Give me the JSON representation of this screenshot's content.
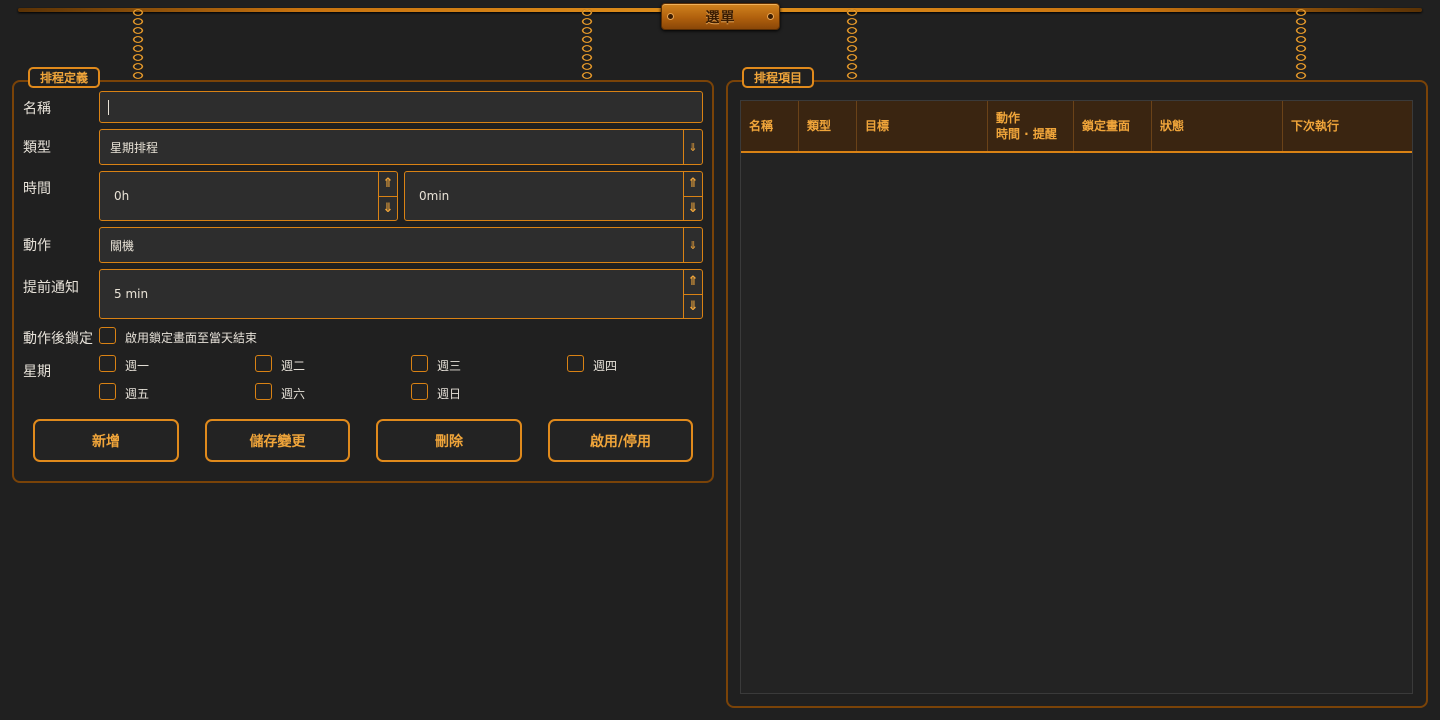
{
  "menu": {
    "label": "選單"
  },
  "schedule_def": {
    "title": "排程定義",
    "name": {
      "label": "名稱",
      "value": ""
    },
    "type": {
      "label": "類型",
      "value": "星期排程"
    },
    "time": {
      "label": "時間",
      "hours": "0h",
      "minutes": "0min"
    },
    "action": {
      "label": "動作",
      "value": "關機"
    },
    "notify": {
      "label": "提前通知",
      "value": "5 min"
    },
    "lock": {
      "label": "動作後鎖定",
      "checkbox_label": "啟用鎖定畫面至當天結束"
    },
    "weekdays": {
      "label": "星期",
      "days": [
        "週一",
        "週二",
        "週三",
        "週四",
        "週五",
        "週六",
        "週日"
      ]
    },
    "buttons": {
      "add": "新增",
      "save": "儲存變更",
      "delete": "刪除",
      "toggle": "啟用/停用"
    }
  },
  "schedule_list": {
    "title": "排程項目",
    "columns": [
      "名稱",
      "類型",
      "目標",
      "動作\n時間 · 提醒",
      "鎖定畫面",
      "狀態",
      "下次執行"
    ],
    "rows": []
  },
  "colors": {
    "accent": "#e08a1c",
    "background": "#202020",
    "field": "#2d2d2d",
    "header": "#3a2511"
  }
}
